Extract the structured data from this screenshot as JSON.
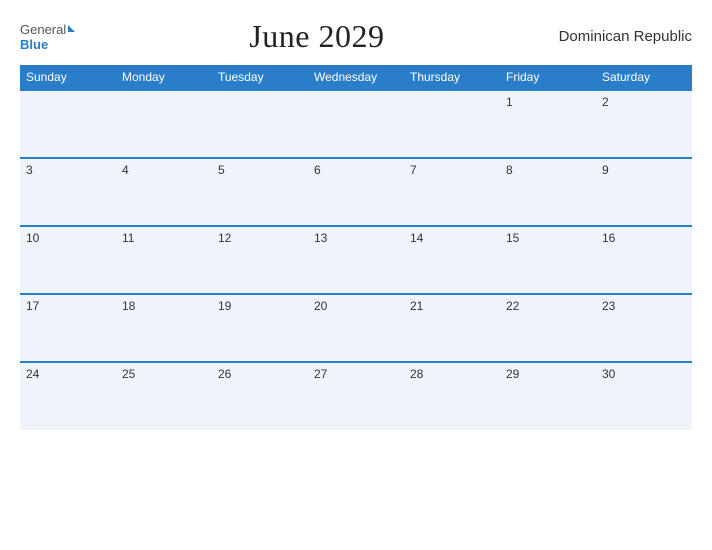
{
  "header": {
    "logo_general": "General",
    "logo_blue": "Blue",
    "title": "June 2029",
    "country": "Dominican Republic"
  },
  "calendar": {
    "weekdays": [
      "Sunday",
      "Monday",
      "Tuesday",
      "Wednesday",
      "Thursday",
      "Friday",
      "Saturday"
    ],
    "weeks": [
      [
        "",
        "",
        "",
        "",
        "",
        "1",
        "2"
      ],
      [
        "3",
        "4",
        "5",
        "6",
        "7",
        "8",
        "9"
      ],
      [
        "10",
        "11",
        "12",
        "13",
        "14",
        "15",
        "16"
      ],
      [
        "17",
        "18",
        "19",
        "20",
        "21",
        "22",
        "23"
      ],
      [
        "24",
        "25",
        "26",
        "27",
        "28",
        "29",
        "30"
      ]
    ]
  }
}
